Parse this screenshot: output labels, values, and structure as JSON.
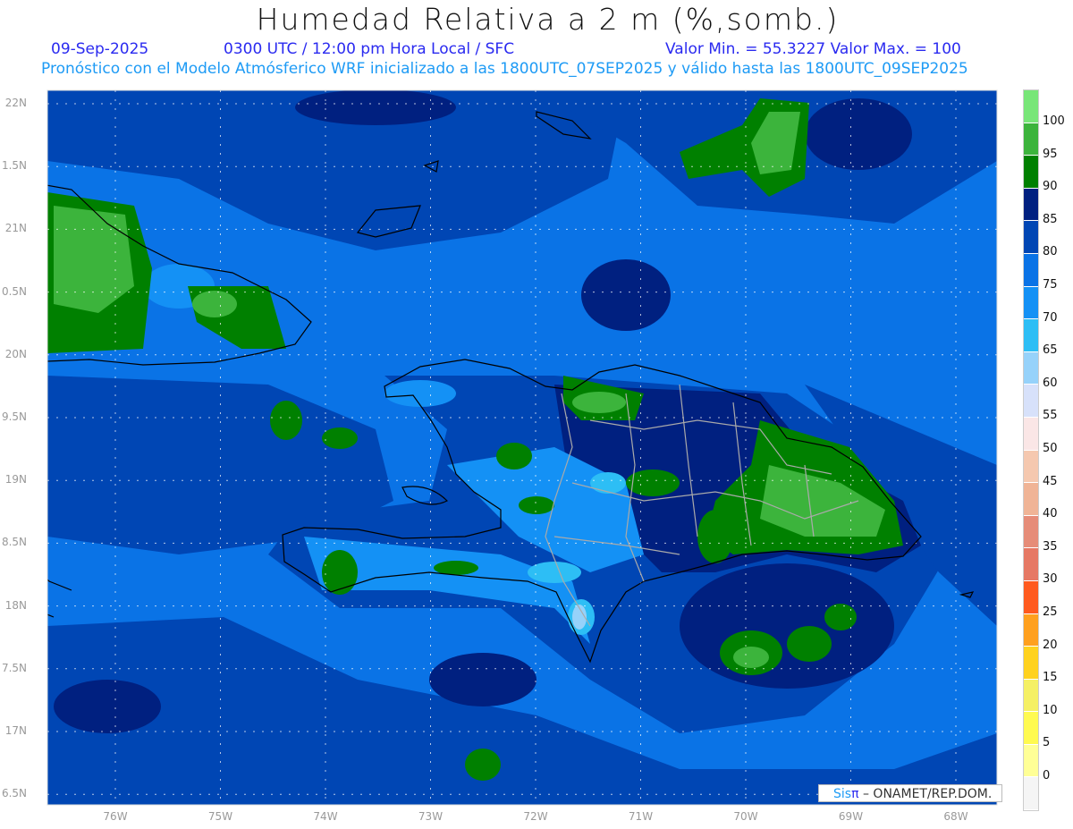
{
  "header": {
    "title": "Humedad Relativa a 2 m (%,somb.)",
    "date": "09-Sep-2025",
    "time": "0300 UTC / 12:00 pm Hora Local / SFC",
    "min_max": "Valor Min. = 55.3227  Valor Max. = 100",
    "subtitle": "Pronóstico con el Modelo Atmósferico WRF inicializado a las 1800UTC_07SEP2025 y válido hasta las  1800UTC_09SEP2025"
  },
  "axes": {
    "lat_labels": [
      "22N",
      "1.5N",
      "21N",
      "0.5N",
      "20N",
      "9.5N",
      "19N",
      "8.5N",
      "18N",
      "7.5N",
      "17N",
      "6.5N"
    ],
    "lon_labels": [
      "76W",
      "75W",
      "74W",
      "73W",
      "72W",
      "71W",
      "70W",
      "69W",
      "68W"
    ]
  },
  "colorbar": {
    "labels": [
      "100",
      "95",
      "90",
      "85",
      "80",
      "75",
      "70",
      "65",
      "60",
      "55",
      "50",
      "45",
      "40",
      "35",
      "30",
      "25",
      "20",
      "15",
      "10",
      "5",
      "0"
    ],
    "colors": [
      "#78e678",
      "#3cb43c",
      "#008000",
      "#002080",
      "#0046b4",
      "#0a73e6",
      "#1491f5",
      "#2dbef5",
      "#96d2fa",
      "#d7e1fa",
      "#fae6e6",
      "#f5c8af",
      "#f0b496",
      "#e68c78",
      "#e67864",
      "#ff5a1e",
      "#ffa01e",
      "#ffd21e",
      "#f5f064",
      "#fffa50",
      "#ffff96",
      "#f5f5f5"
    ]
  },
  "credit": {
    "sis": "Sis",
    "pi": "π",
    "org": "– ONAMET/REP.DOM."
  }
}
